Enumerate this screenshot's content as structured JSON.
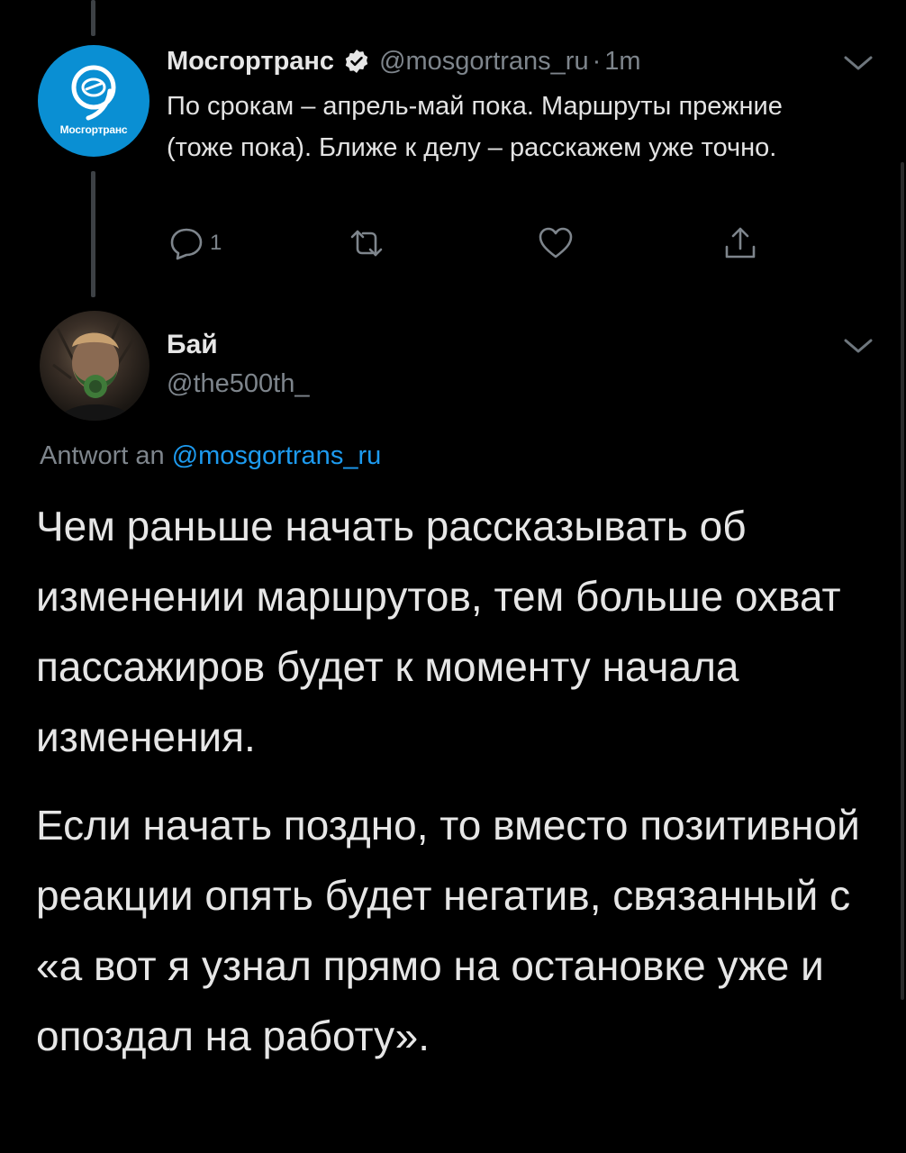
{
  "parent_tweet": {
    "avatar_text": "Мосгортранс",
    "name": "Мосгортранс",
    "handle": "@mosgortrans_ru",
    "separator": "·",
    "time": "1m",
    "text": "По срокам – апрель-май пока. Маршруты прежние (тоже пока). Ближе к делу – расскажем уже точно.",
    "reply_count": "1",
    "icons": [
      "reply-icon",
      "retweet-icon",
      "like-icon",
      "share-icon",
      "verified-badge-icon",
      "chevron-down-icon"
    ]
  },
  "reply_tweet": {
    "name": "Бай",
    "handle": "@the500th_",
    "reply_prefix": "Antwort an",
    "reply_mention": "@mosgortrans_ru",
    "paragraphs": [
      "Чем раньше начать рассказывать об изменении маршрутов, тем больше охват пассажиров будет к моменту начала изменения.",
      "Если начать поздно, то вместо позитивной реакции опять будет негатив, связанный с «а вот я узнал прямо на остановке уже и опоздал на работу»."
    ]
  },
  "colors": {
    "background": "#000000",
    "text": "#e6e6e6",
    "secondary": "#7e858c",
    "link": "#1d9bf0",
    "brand": "#0a8fd3"
  }
}
